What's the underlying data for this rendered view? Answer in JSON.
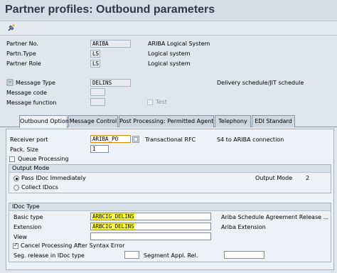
{
  "window": {
    "title": "Partner profiles: Outbound parameters"
  },
  "toolbar": {
    "icon": "display-change-icon"
  },
  "header": {
    "partner_no": {
      "label": "Partner No.",
      "value": "ARIBA",
      "desc": "ARIBA Logical System"
    },
    "partn_type": {
      "label": "Partn.Type",
      "value": "LS",
      "desc": "Logical system"
    },
    "partner_role": {
      "label": "Partner Role",
      "value": "LS",
      "desc": "Logical system"
    },
    "message_type": {
      "label": "Message Type",
      "value": "DELINS",
      "desc": "Delivery schedule/JIT schedule"
    },
    "message_code": {
      "label": "Message code",
      "value": ""
    },
    "message_function": {
      "label": "Message function",
      "value": ""
    },
    "test": {
      "label": "Test",
      "checked": false
    }
  },
  "tabs": [
    {
      "label": "Outbound Options",
      "active": true
    },
    {
      "label": "Message Control",
      "active": false
    },
    {
      "label": "Post Processing: Permitted Agent",
      "active": false
    },
    {
      "label": "Telephony",
      "active": false
    },
    {
      "label": "EDI Standard",
      "active": false
    }
  ],
  "outbound": {
    "receiver_port": {
      "label": "Receiver port",
      "value": "ARIBA_PO",
      "type": "Transactional RFC",
      "desc": "S4 to ARIBA connection"
    },
    "pack_size": {
      "label": "Pack. Size",
      "value": "1"
    },
    "queue_processing": {
      "label": "Queue Processing",
      "checked": false
    }
  },
  "output_mode": {
    "header": "Output Mode",
    "pass_immediately": {
      "label": "Pass IDoc Immediately",
      "checked": true
    },
    "collect": {
      "label": "Collect IDocs",
      "checked": false
    },
    "output_mode_label": "Output Mode",
    "output_mode_value": "2"
  },
  "idoc_type": {
    "header": "IDoc Type",
    "basic_type": {
      "label": "Basic type",
      "value": "ARBCIG_DELINS",
      "desc": "Ariba Schedule Agreement Release ..."
    },
    "extension": {
      "label": "Extension",
      "value": "ARBCIG_DELINS",
      "desc": "Ariba Extension"
    },
    "view": {
      "label": "View",
      "value": ""
    },
    "cancel_processing": {
      "label": "Cancel Processing After Syntax Error",
      "checked": true
    },
    "seg_release": {
      "label": "Seg. release in IDoc type",
      "value": ""
    },
    "segment_appl_rel": {
      "label": "Segment Appl. Rel.",
      "value": ""
    }
  },
  "colors": {
    "highlight": "#ffff3a",
    "background": "#dfe6ee",
    "title": "#2a3a4a"
  }
}
